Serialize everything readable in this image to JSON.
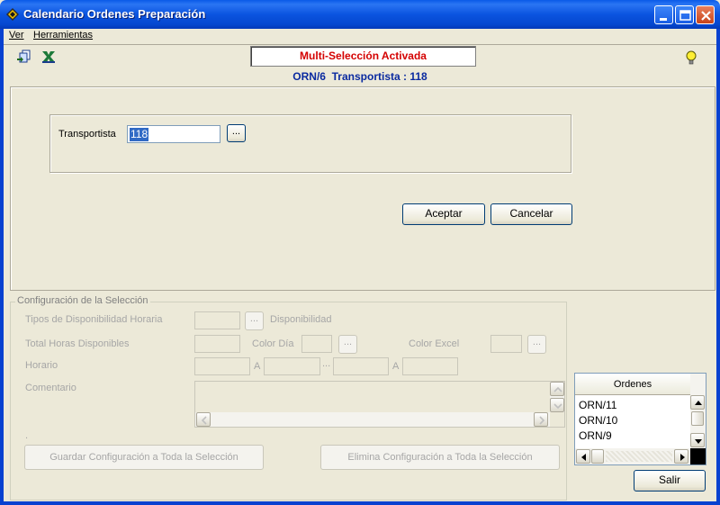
{
  "window": {
    "title": "Calendario Ordenes Preparación"
  },
  "menu": {
    "items": [
      "Ver",
      "Herramientas"
    ]
  },
  "banner": {
    "text": "Multi-Selección Activada"
  },
  "status": {
    "text": "ORN/6  Transportista : 118"
  },
  "transportista": {
    "label": "Transportista",
    "value": "118",
    "lookup": "..."
  },
  "actions": {
    "accept": "Aceptar",
    "cancel": "Cancelar"
  },
  "config": {
    "legend": "Configuración de la Selección",
    "tipos_label": "Tipos de Disponibilidad Horaria",
    "tipos_lookup": "...",
    "disponibilidad_label": "Disponibilidad",
    "total_horas_label": "Total Horas Disponibles",
    "color_dia_label": "Color Día",
    "color_dia_lookup": "...",
    "color_excel_label": "Color Excel",
    "color_excel_lookup": "...",
    "horario_label": "Horario",
    "a1": "A",
    "sep": "...",
    "a2": "A",
    "comentario_label": "Comentario",
    "dot": ".",
    "guardar": "Guardar Configuración a Toda la Selección",
    "elimina": "Elimina Configuración a Toda la Selección"
  },
  "ordenes": {
    "header": "Ordenes",
    "rows": [
      "ORN/11",
      "ORN/10",
      "ORN/9"
    ]
  },
  "exit": {
    "label": "Salir"
  },
  "colors": {
    "banner_text": "#d40000",
    "status_text": "#0a2aa0",
    "selection": "#316ac5"
  }
}
